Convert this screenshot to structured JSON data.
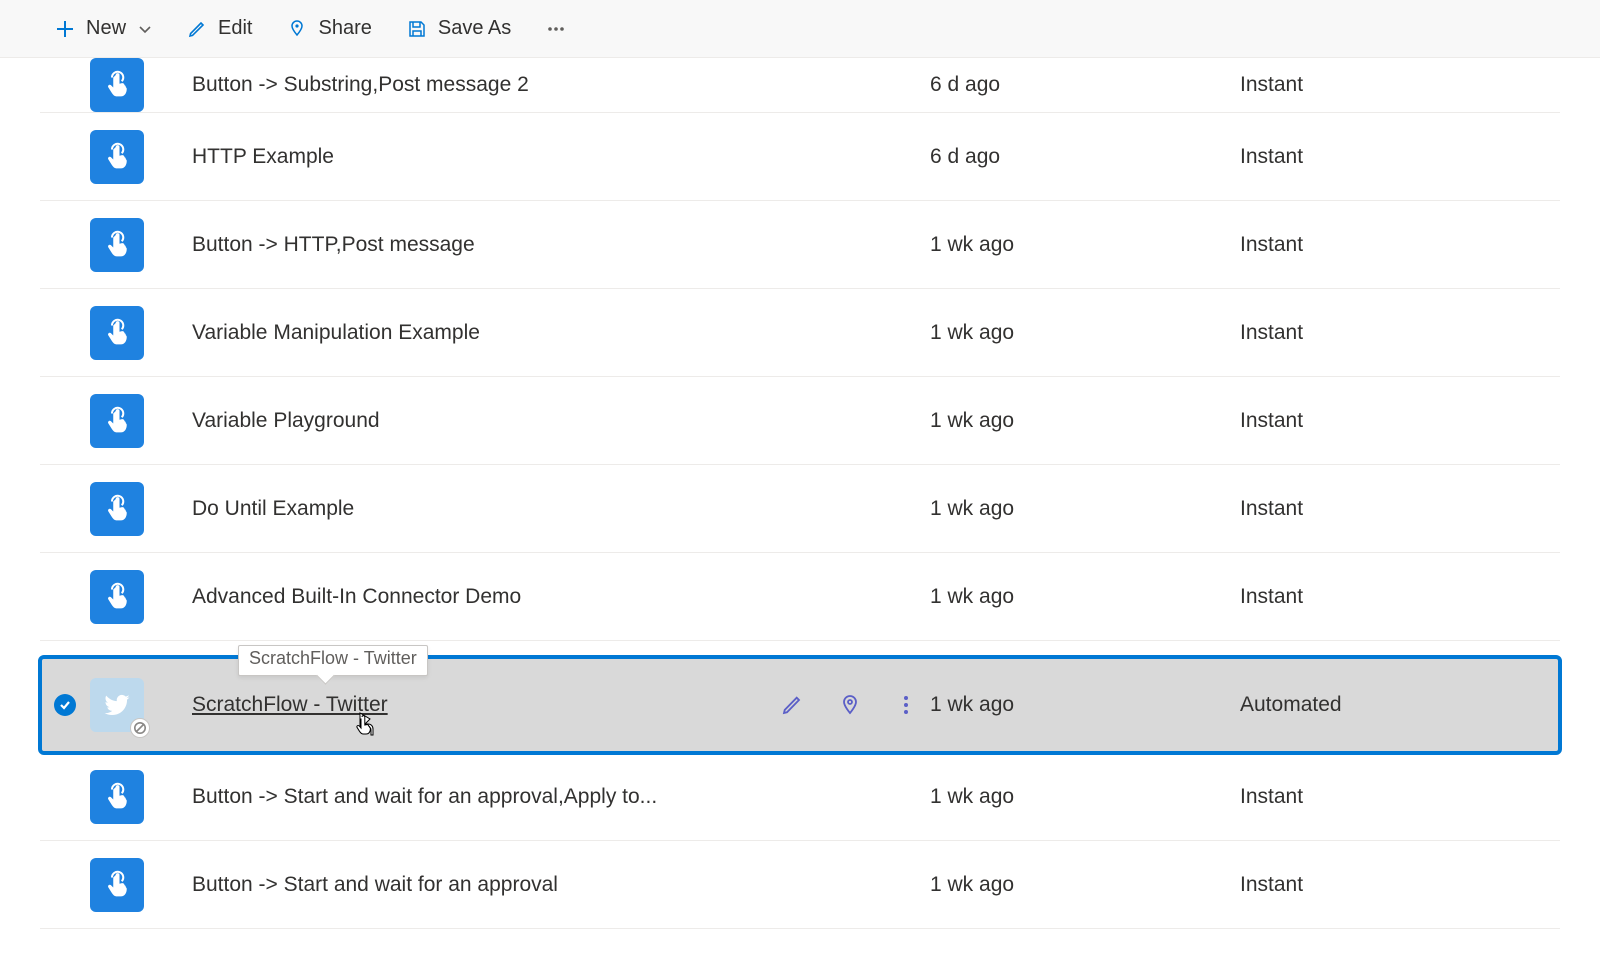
{
  "toolbar": {
    "new": "New",
    "edit": "Edit",
    "share": "Share",
    "save_as": "Save As"
  },
  "rows": [
    {
      "name": "Button -> Substring,Post message 2",
      "modified": "6 d ago",
      "type": "Instant",
      "icon": "button",
      "selected": false,
      "first": true
    },
    {
      "name": "HTTP Example",
      "modified": "6 d ago",
      "type": "Instant",
      "icon": "button",
      "selected": false
    },
    {
      "name": "Button -> HTTP,Post message",
      "modified": "1 wk ago",
      "type": "Instant",
      "icon": "button",
      "selected": false
    },
    {
      "name": "Variable Manipulation Example",
      "modified": "1 wk ago",
      "type": "Instant",
      "icon": "button",
      "selected": false
    },
    {
      "name": "Variable Playground",
      "modified": "1 wk ago",
      "type": "Instant",
      "icon": "button",
      "selected": false
    },
    {
      "name": "Do Until Example",
      "modified": "1 wk ago",
      "type": "Instant",
      "icon": "button",
      "selected": false
    },
    {
      "name": "Advanced Built-In Connector Demo",
      "modified": "1 wk ago",
      "type": "Instant",
      "icon": "button",
      "selected": false
    },
    {
      "name": "ScratchFlow - Twitter",
      "modified": "1 wk ago",
      "type": "Automated",
      "icon": "twitter",
      "selected": true,
      "disabled": true,
      "tooltip": "ScratchFlow - Twitter"
    },
    {
      "name": "Button -> Start and wait for an approval,Apply to...",
      "modified": "1 wk ago",
      "type": "Instant",
      "icon": "button",
      "selected": false
    },
    {
      "name": "Button -> Start and wait for an approval",
      "modified": "1 wk ago",
      "type": "Instant",
      "icon": "button",
      "selected": false
    }
  ]
}
